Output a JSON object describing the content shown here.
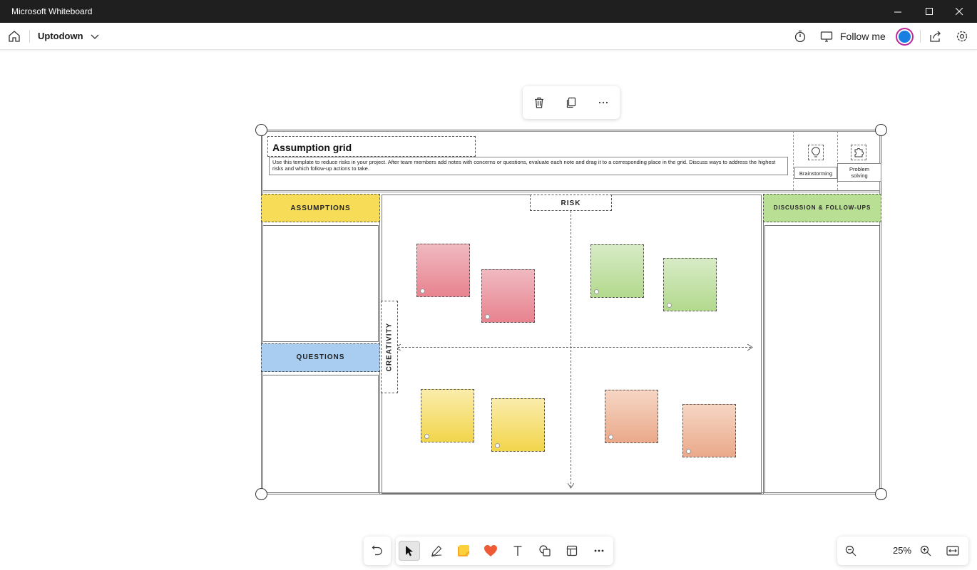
{
  "window": {
    "title": "Microsoft Whiteboard",
    "controls": [
      "minimize-icon",
      "maximize-icon",
      "close-icon"
    ]
  },
  "appbar": {
    "board_name": "Uptodown",
    "follow_label": "Follow me",
    "icons": [
      "home-icon",
      "chevron-down-icon",
      "timer-icon",
      "follow-icon",
      "share-icon",
      "settings-icon"
    ],
    "avatar_color": "#1a7fe0"
  },
  "selection_toolbar": {
    "icons": [
      "delete-icon",
      "copy-icon",
      "more-icon"
    ]
  },
  "template": {
    "title": "Assumption grid",
    "description": "Use this template to reduce risks in your project. After team members add notes with concerns or questions, evaluate each note and drag it to a corresponding place in the grid. Discuss ways to address the highest risks and which follow-up actions to take.",
    "tools": [
      {
        "label": "Brainstorming",
        "icon": "lightbulb-icon"
      },
      {
        "label": "Problem solving",
        "icon": "puzzle-icon"
      }
    ],
    "assumptions_label": "ASSUMPTIONS",
    "questions_label": "QUESTIONS",
    "discussion_label": "DISCUSSION & FOLLOW-UPS",
    "risk_label": "RISK",
    "creativity_label": "CREATIVITY",
    "colors": {
      "assumptions": "#f7dd57",
      "questions": "#a8cdf0",
      "discussion": "#b9df95"
    },
    "notes": [
      {
        "quadrant": "top-left",
        "color": "pink"
      },
      {
        "quadrant": "top-left",
        "color": "pink"
      },
      {
        "quadrant": "top-right",
        "color": "green"
      },
      {
        "quadrant": "top-right",
        "color": "green"
      },
      {
        "quadrant": "bottom-left",
        "color": "yellow"
      },
      {
        "quadrant": "bottom-left",
        "color": "yellow"
      },
      {
        "quadrant": "bottom-right",
        "color": "orange"
      },
      {
        "quadrant": "bottom-right",
        "color": "orange"
      }
    ]
  },
  "bottom_toolbar": {
    "tools": [
      "undo-icon",
      "select-icon",
      "pen-icon",
      "sticky-note-icon",
      "reaction-icon",
      "text-icon",
      "shapes-icon",
      "template-icon",
      "more-icon"
    ],
    "active_tool": "select-icon"
  },
  "zoom": {
    "value": "25%",
    "icons": [
      "zoom-out-icon",
      "zoom-in-icon",
      "fit-to-screen-icon"
    ]
  }
}
